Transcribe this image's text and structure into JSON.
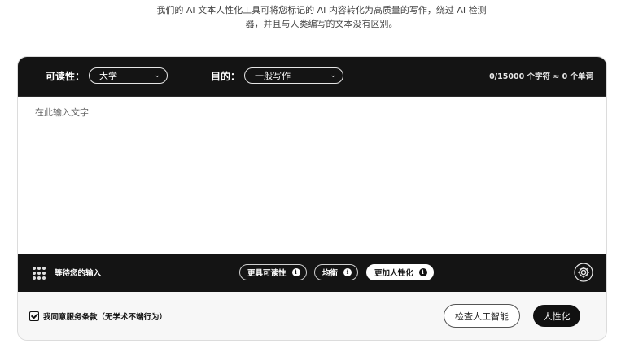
{
  "intro": {
    "line1": "我们的 AI 文本人性化工具可将您标记的 AI 内容转化为高质量的写作，绕过 AI 检测",
    "line2": "器，并且与人类编写的文本没有区别。"
  },
  "topbar": {
    "readability_label": "可读性：",
    "readability_value": "大学",
    "purpose_label": "目的：",
    "purpose_value": "一般写作",
    "counter": "0/15000 个字符 ≈ 0 个单词"
  },
  "editor": {
    "placeholder": "在此输入文字"
  },
  "bottombar": {
    "status": "等待您的输入",
    "modes": [
      {
        "label": "更具可读性",
        "active": false
      },
      {
        "label": "均衡",
        "active": false
      },
      {
        "label": "更加人性化",
        "active": true
      }
    ],
    "info_glyph": "i"
  },
  "footer": {
    "agree_text": "我同意服务条款（无学术不端行为）",
    "check_button": "检查人工智能",
    "humanize_button": "人性化"
  }
}
